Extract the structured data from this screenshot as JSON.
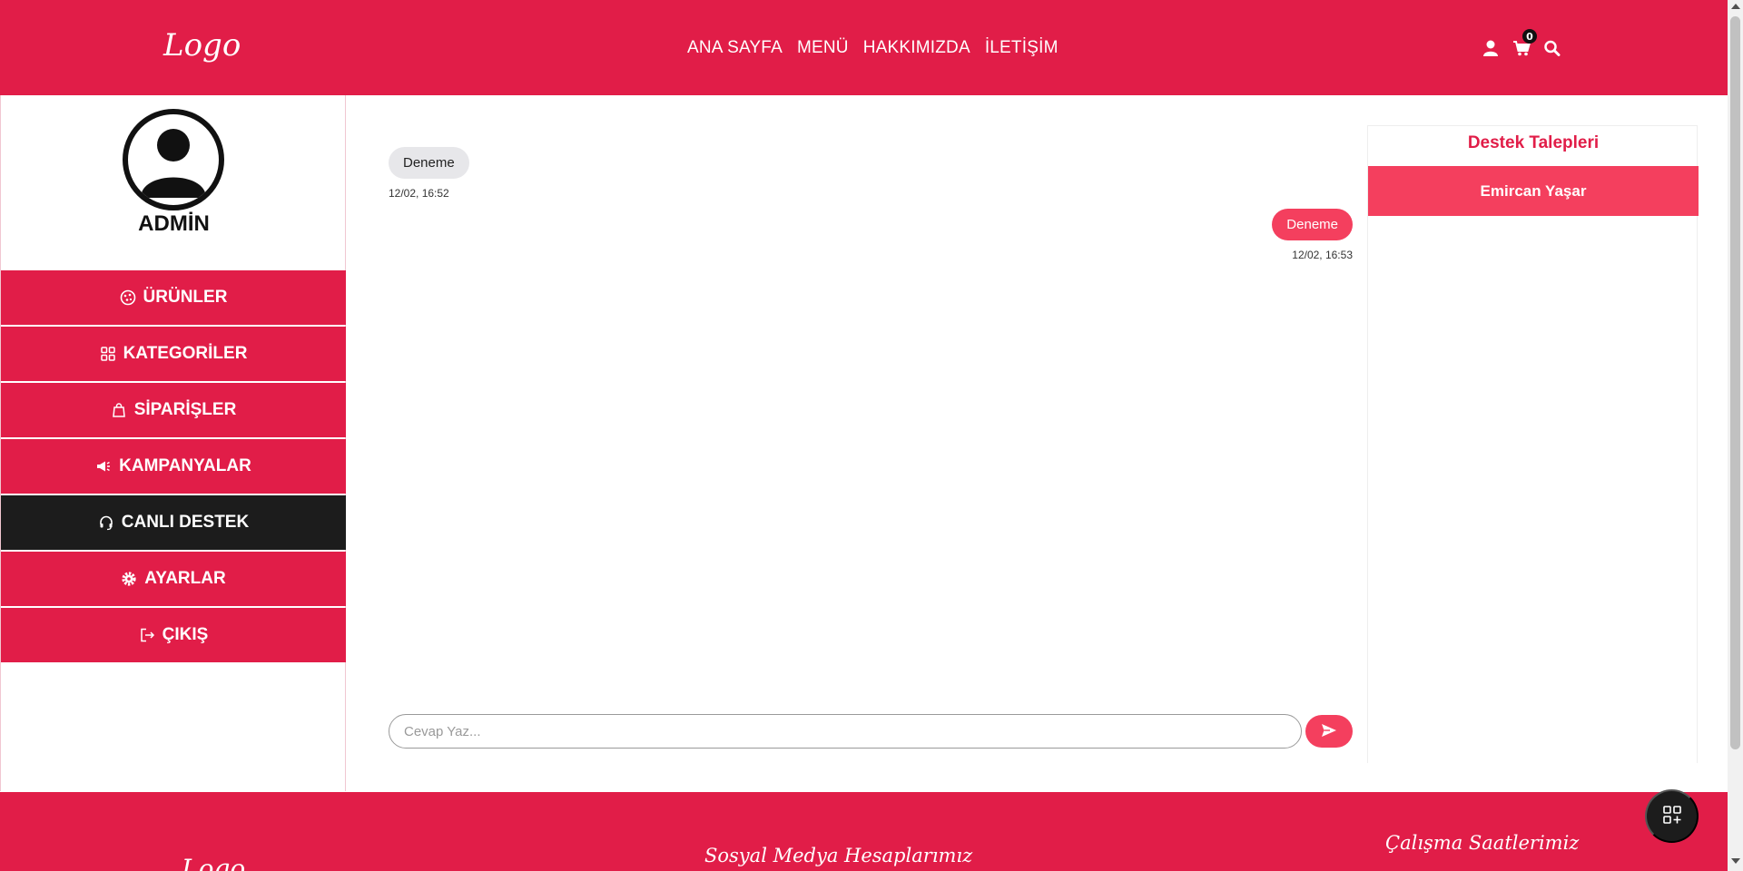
{
  "header": {
    "logo": "Logo",
    "nav": [
      "ANA SAYFA",
      "MENÜ",
      "HAKKIMIZDA",
      "İLETİŞİM"
    ],
    "cart_count": "0",
    "icons": [
      "user-icon",
      "cart-icon",
      "search-icon"
    ]
  },
  "sidebar": {
    "user_name": "ADMİN",
    "items": [
      {
        "label": "ÜRÜNLER",
        "icon": "pizza-icon",
        "active": false
      },
      {
        "label": "KATEGORİLER",
        "icon": "grid-icon",
        "active": false
      },
      {
        "label": "SİPARİŞLER",
        "icon": "bag-icon",
        "active": false
      },
      {
        "label": "KAMPANYALAR",
        "icon": "megaphone-icon",
        "active": false
      },
      {
        "label": "CANLI DESTEK",
        "icon": "headset-icon",
        "active": true
      },
      {
        "label": "AYARLAR",
        "icon": "gear-icon",
        "active": false
      },
      {
        "label": "ÇIKIŞ",
        "icon": "logout-icon",
        "active": false
      }
    ]
  },
  "chat": {
    "messages": [
      {
        "direction": "in",
        "text": "Deneme",
        "time": "12/02, 16:52"
      },
      {
        "direction": "out",
        "text": "Deneme",
        "time": "12/02, 16:53"
      }
    ],
    "reply_placeholder": "Cevap Yaz..."
  },
  "tickets": {
    "title": "Destek Talepleri",
    "items": [
      "Emircan Yaşar"
    ]
  },
  "footer": {
    "logo": "Logo",
    "social_title": "Sosyal Medya Hesaplarımız",
    "hours_title": "Çalışma Saatlerimiz"
  },
  "colors": {
    "primary": "#e11d48",
    "accent": "#f43f5e",
    "dark": "#1c1c1c"
  }
}
